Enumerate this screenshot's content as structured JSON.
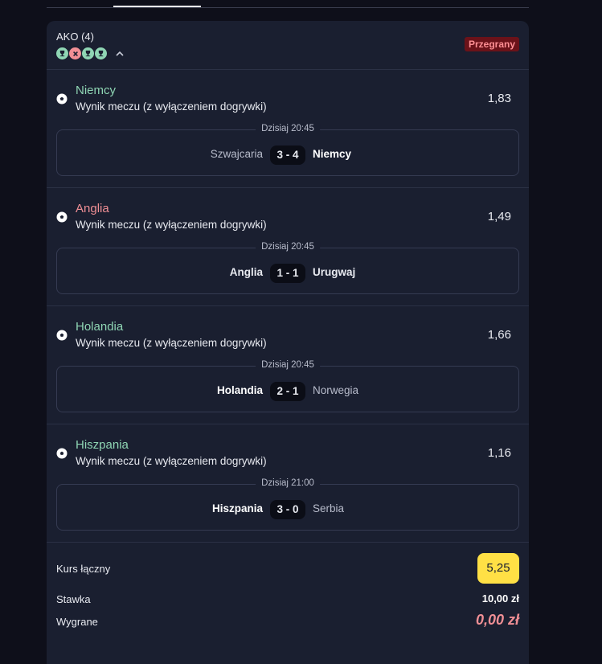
{
  "coupon": {
    "title": "AKO (4)",
    "status_badge": "Przegrany",
    "result_dots": [
      "won",
      "lost",
      "won",
      "won"
    ]
  },
  "selections": [
    {
      "team": "Niemcy",
      "result": "won",
      "market": "Wynik meczu (z wyłączeniem dogrywki)",
      "odds": "1,83",
      "date": "Dzisiaj 20:45",
      "home": "Szwajcaria",
      "away": "Niemcy",
      "score": "3 - 4"
    },
    {
      "team": "Anglia",
      "result": "lost",
      "market": "Wynik meczu (z wyłączeniem dogrywki)",
      "odds": "1,49",
      "date": "Dzisiaj 20:45",
      "home": "Anglia",
      "away": "Urugwaj",
      "score": "1 - 1"
    },
    {
      "team": "Holandia",
      "result": "won",
      "market": "Wynik meczu (z wyłączeniem dogrywki)",
      "odds": "1,66",
      "date": "Dzisiaj 20:45",
      "home": "Holandia",
      "away": "Norwegia",
      "score": "2 - 1"
    },
    {
      "team": "Hiszpania",
      "result": "won",
      "market": "Wynik meczu (z wyłączeniem dogrywki)",
      "odds": "1,16",
      "date": "Dzisiaj 21:00",
      "home": "Hiszpania",
      "away": "Serbia",
      "score": "3 - 0"
    }
  ],
  "summary": {
    "total_odds_label": "Kurs łączny",
    "total_odds": "5,25",
    "stake_label": "Stawka",
    "stake": "10,00 zł",
    "winnings_label": "Wygrane",
    "winnings": "0,00 zł"
  },
  "colors": {
    "won": "#8fd6b4",
    "lost": "#f08f95",
    "accent": "#ffe045",
    "badge_bg": "#6b1219"
  },
  "icons": {
    "selection_icon": "soccer-ball-icon",
    "won_dot_icon": "trophy-icon",
    "lost_dot_icon": "x-icon",
    "collapse_icon": "chevron-up-icon"
  }
}
